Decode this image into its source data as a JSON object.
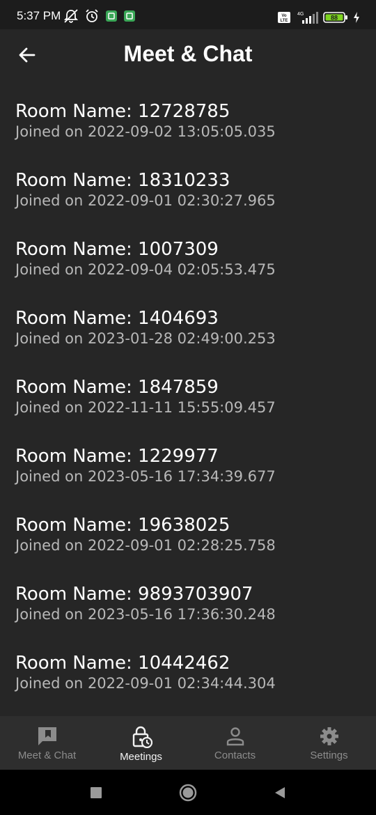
{
  "status_bar": {
    "time": "5:37 PM",
    "battery": "88",
    "network": "4G",
    "volte": "Vo LTE",
    "icons": [
      "alarm-off-icon",
      "alarm-clock-icon",
      "notification-app-icon",
      "notification-app-icon",
      "volte-icon",
      "signal-icon",
      "battery-icon",
      "charging-icon"
    ]
  },
  "appbar": {
    "title": "Meet & Chat",
    "back_icon": "arrow-back-icon"
  },
  "rooms": [
    {
      "name": "Room Name: 12728785",
      "joined": "Joined on 2022-09-02 13:05:05.035"
    },
    {
      "name": "Room Name: 18310233",
      "joined": "Joined on 2022-09-01 02:30:27.965"
    },
    {
      "name": "Room Name: 1007309",
      "joined": "Joined on 2022-09-04 02:05:53.475"
    },
    {
      "name": "Room Name: 1404693",
      "joined": "Joined on 2023-01-28 02:49:00.253"
    },
    {
      "name": "Room Name: 1847859",
      "joined": "Joined on 2022-11-11 15:55:09.457"
    },
    {
      "name": "Room Name: 1229977",
      "joined": "Joined on 2023-05-16 17:34:39.677"
    },
    {
      "name": "Room Name: 19638025",
      "joined": "Joined on 2022-09-01 02:28:25.758"
    },
    {
      "name": "Room Name: 9893703907",
      "joined": "Joined on 2023-05-16 17:36:30.248"
    },
    {
      "name": "Room Name: 10442462",
      "joined": "Joined on 2022-09-01 02:34:44.304"
    }
  ],
  "bottom_nav": [
    {
      "label": "Meet & Chat",
      "icon": "chat-bookmark-icon",
      "active": false
    },
    {
      "label": "Meetings",
      "icon": "lock-clock-icon",
      "active": true
    },
    {
      "label": "Contacts",
      "icon": "person-icon",
      "active": false
    },
    {
      "label": "Settings",
      "icon": "gear-icon",
      "active": false
    }
  ],
  "system_nav": {
    "icons": [
      "recents-square-icon",
      "home-circle-icon",
      "back-triangle-icon"
    ]
  },
  "colors": {
    "background": "#262626",
    "status_bar": "#1c1c1c",
    "bottom_nav": "#2e2e2e",
    "primary_text": "#ffffff",
    "secondary_text": "#b8b8b8",
    "battery_green": "#7ed321"
  }
}
